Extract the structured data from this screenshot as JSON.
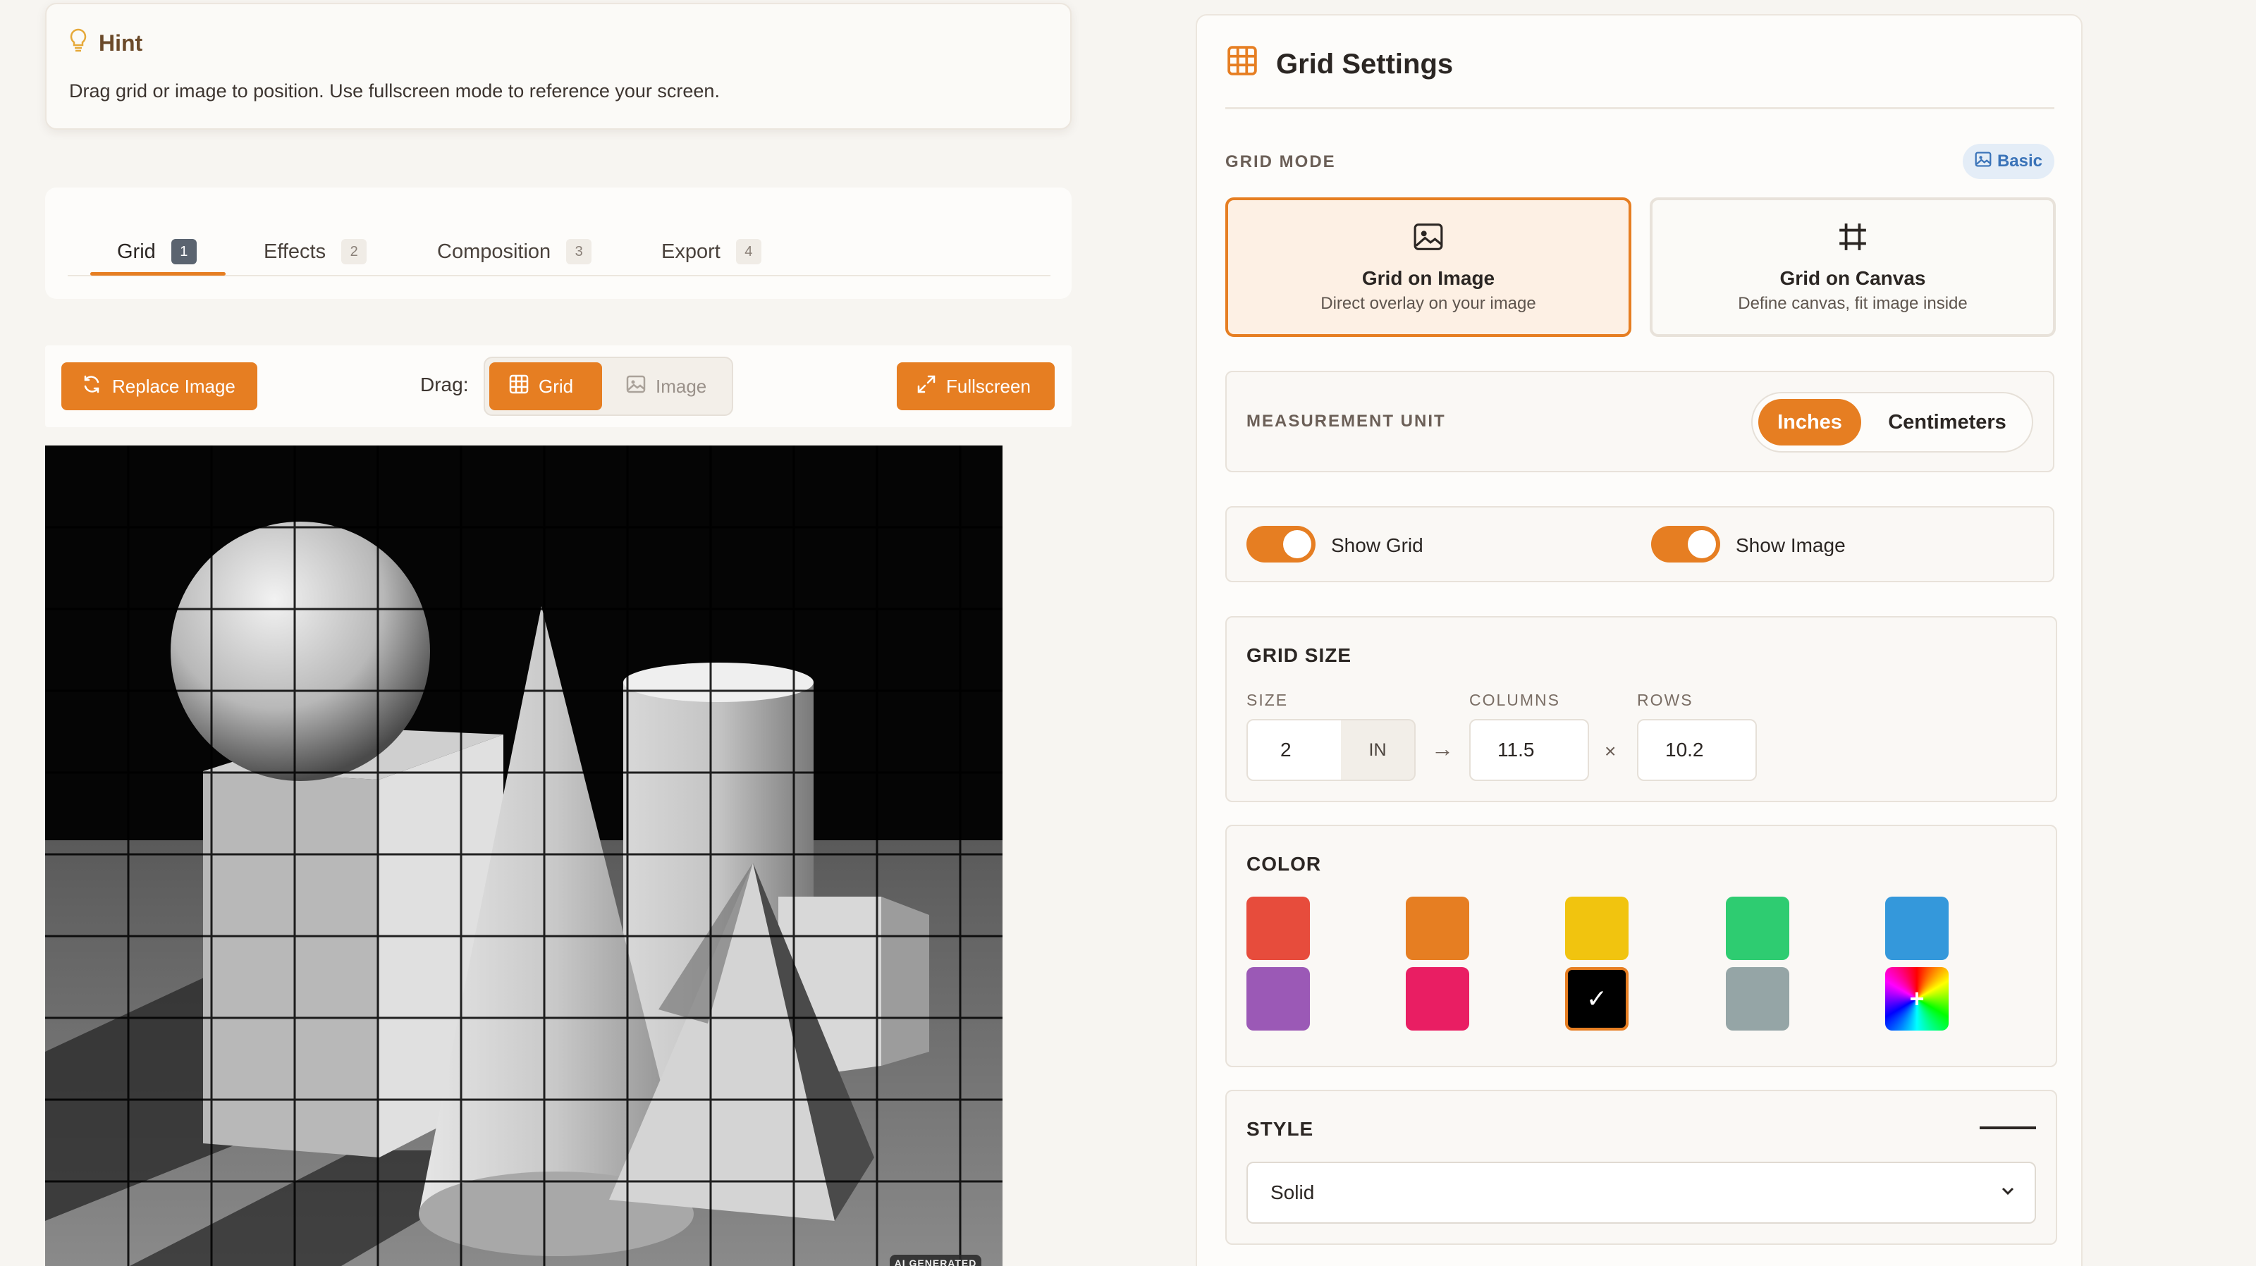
{
  "hint": {
    "title": "Hint",
    "text": "Drag grid or image to position. Use fullscreen mode to reference your screen."
  },
  "tabs": [
    {
      "label": "Grid",
      "num": "1",
      "active": true
    },
    {
      "label": "Effects",
      "num": "2"
    },
    {
      "label": "Composition",
      "num": "3"
    },
    {
      "label": "Export",
      "num": "4"
    }
  ],
  "toolbar": {
    "replace_label": "Replace Image",
    "drag_label": "Drag:",
    "drag_grid": "Grid",
    "drag_image": "Image",
    "fullscreen_label": "Fullscreen"
  },
  "canvas": {
    "badge": "AI GENERATED"
  },
  "settings": {
    "title": "Grid Settings",
    "grid_mode_label": "GRID MODE",
    "mode_badge": "Basic",
    "modes": [
      {
        "title": "Grid on Image",
        "subtitle": "Direct overlay on your image",
        "selected": true
      },
      {
        "title": "Grid on Canvas",
        "subtitle": "Define canvas, fit image inside"
      }
    ],
    "measurement_label": "MEASUREMENT UNIT",
    "units": [
      "Inches",
      "Centimeters"
    ],
    "selected_unit": "Inches",
    "show_grid_label": "Show Grid",
    "show_image_label": "Show Image",
    "show_grid": true,
    "show_image": true,
    "grid_size": {
      "title": "GRID SIZE",
      "size_label": "SIZE",
      "columns_label": "COLUMNS",
      "rows_label": "ROWS",
      "size_value": "2",
      "size_unit": "IN",
      "arrow": "→",
      "columns_value": "11.5",
      "times": "×",
      "rows_value": "10.2"
    },
    "color": {
      "title": "COLOR",
      "swatches": [
        "#e74c3c",
        "#e67e22",
        "#f1c40f",
        "#2ecc71",
        "#3498db",
        "#9b59b6",
        "#e91e63",
        "#000000",
        "#95a5a6"
      ],
      "selected": "#000000",
      "check": "✓",
      "custom_plus": "+"
    },
    "style": {
      "title": "STYLE",
      "value": "Solid",
      "chevron": "⌄"
    }
  }
}
